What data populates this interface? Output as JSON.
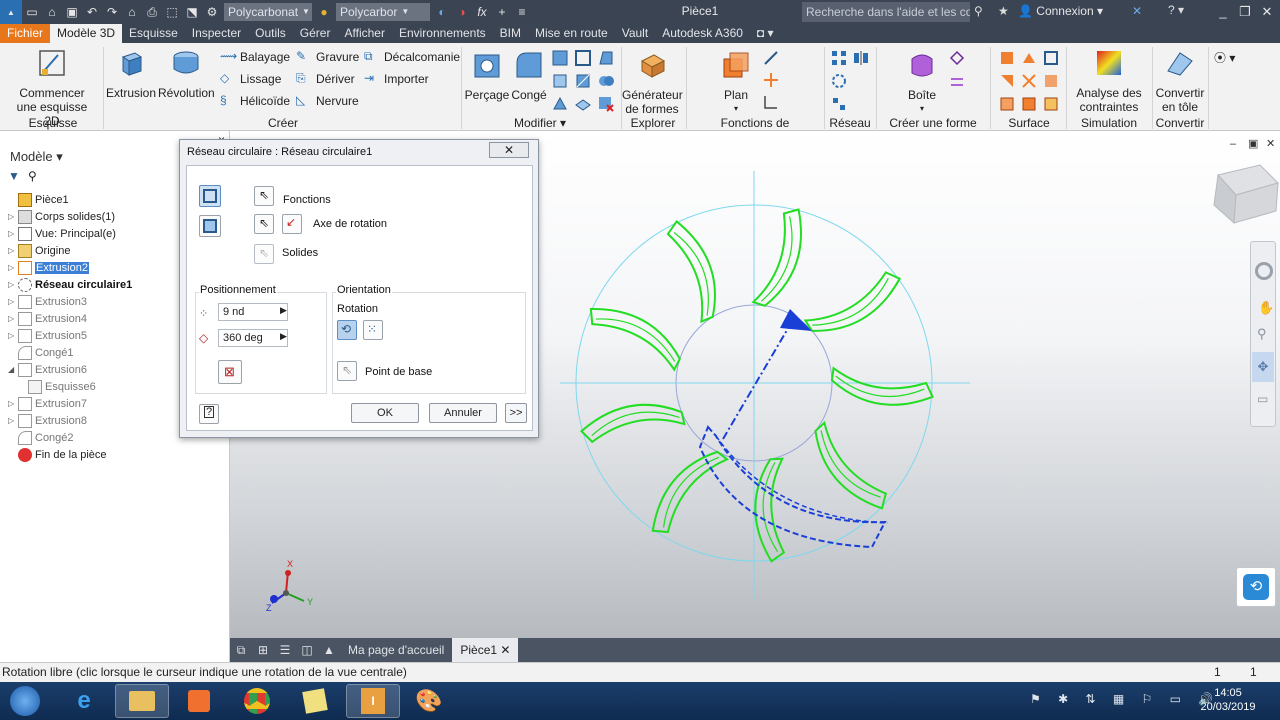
{
  "titlebar": {
    "app_title": "Pièce1",
    "material_dropdown": "Polycarbonat",
    "appearance_dropdown": "Polycarbor",
    "help_search_placeholder": "Recherche dans l'aide et les com",
    "login_label": "Connexion",
    "fx_label": "fx"
  },
  "menu": {
    "tabs": [
      "Fichier",
      "Modèle 3D",
      "Esquisse",
      "Inspecter",
      "Outils",
      "Gérer",
      "Afficher",
      "Environnements",
      "BIM",
      "Mise en route",
      "Vault",
      "Autodesk A360"
    ]
  },
  "ribbon": {
    "start_sketch": "Commencer une esquisse 2D",
    "extrusion": "Extrusion",
    "revolution": "Révolution",
    "balayage": "Balayage",
    "lissage": "Lissage",
    "helicoide": "Hélicoïde",
    "gravure": "Gravure",
    "deriver": "Dériver",
    "nervure": "Nervure",
    "decalcomanie": "Décalcomanie",
    "importer": "Importer",
    "percage": "Perçage",
    "conge": "Congé",
    "generateur": "Générateur de formes",
    "plan": "Plan",
    "boite": "Boîte",
    "analyse": "Analyse des contraintes",
    "convertir": "Convertir en tôle",
    "panels": {
      "esquisse": "Esquisse",
      "creer": "Créer",
      "modifier": "Modifier",
      "explorer": "Explorer",
      "fonctions": "Fonctions de construction",
      "reseau": "Réseau",
      "forme_libre": "Créer une forme libre",
      "surface": "Surface",
      "simulation": "Simulation",
      "convertir": "Convertir"
    }
  },
  "browser": {
    "title": "Modèle",
    "items": [
      {
        "label": "Pièce1"
      },
      {
        "label": "Corps solides(1)"
      },
      {
        "label": "Vue: Principal(e)"
      },
      {
        "label": "Origine"
      },
      {
        "label": "Extrusion2"
      },
      {
        "label": "Réseau circulaire1"
      },
      {
        "label": "Extrusion3"
      },
      {
        "label": "Extrusion4"
      },
      {
        "label": "Extrusion5"
      },
      {
        "label": "Congé1"
      },
      {
        "label": "Extrusion6"
      },
      {
        "label": "Esquisse6"
      },
      {
        "label": "Extrusion7"
      },
      {
        "label": "Extrusion8"
      },
      {
        "label": "Congé2"
      },
      {
        "label": "Fin de la pièce"
      }
    ]
  },
  "dialog": {
    "title": "Réseau circulaire : Réseau circulaire1",
    "fonctions": "Fonctions",
    "axe": "Axe de rotation",
    "solides": "Solides",
    "positionnement": "Positionnement",
    "count": "9 nd",
    "angle": "360 deg",
    "orientation": "Orientation",
    "rotation": "Rotation",
    "point_base": "Point de base",
    "ok": "OK",
    "annuler": "Annuler",
    "more": ">>",
    "help": "?"
  },
  "doc_tabs": {
    "home": "Ma page d'accueil",
    "part": "Pièce1"
  },
  "status": {
    "message": "Rotation libre (clic lorsque le curseur indique une rotation de la vue centrale)",
    "n1": "1",
    "n2": "1"
  },
  "clock": {
    "time": "14:05",
    "date": "20/03/2019"
  },
  "colors": {
    "blade_green": "#22dd22",
    "preview_blue": "#1a3fd6",
    "circle_cyan": "#7fd8ee",
    "file_tab_orange": "#e8761b",
    "title_dark": "#3b4453"
  }
}
